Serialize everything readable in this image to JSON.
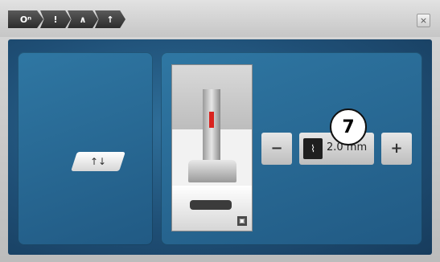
{
  "topbar": {
    "breadcrumbs": [
      {
        "icon": "settings-key-icon",
        "label": "Oⁿ"
      },
      {
        "icon": "info-icon",
        "label": "!"
      },
      {
        "icon": "presser-foot-icon",
        "label": "∧"
      },
      {
        "icon": "foot-pressure-icon",
        "label": "↑"
      }
    ],
    "close_label": "×"
  },
  "left_panel": {
    "foot_button_label": "↑↓"
  },
  "preview": {
    "zoom_label": "▣"
  },
  "controls": {
    "minus_label": "−",
    "plus_label": "+",
    "value_icon": "presser-foot-pressure-icon",
    "value_text": "2.0 mm"
  },
  "callout": {
    "number": "7"
  }
}
